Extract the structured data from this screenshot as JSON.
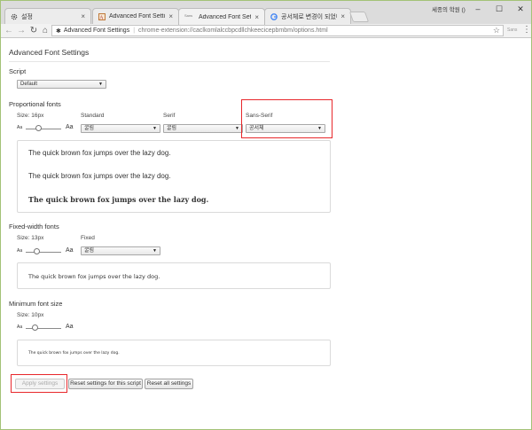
{
  "browser": {
    "tabs": [
      {
        "title": "설정",
        "active": false
      },
      {
        "title": "Advanced Font Settings",
        "active": false
      },
      {
        "title": "Advanced Font Settings",
        "active": true
      },
      {
        "title": "공서체로 변경이 되었네",
        "active": false
      }
    ],
    "profile": "세종의 학원 ()",
    "omnibox": {
      "site_label": "Advanced Font Settings",
      "url": "chrome-extension://caclkomlalccbpcdllchkeecicepbmbm/options.html"
    },
    "extension_label": "Sans"
  },
  "page": {
    "title": "Advanced Font Settings",
    "script": {
      "heading": "Script",
      "value": "Default"
    },
    "proportional": {
      "heading": "Proportional fonts",
      "size_label": "Size: 16px",
      "slider_min_glyph": "Aa",
      "slider_max_glyph": "Aa",
      "slider_level": 0.35,
      "standard": {
        "label": "Standard",
        "value": "굴림"
      },
      "serif": {
        "label": "Serif",
        "value": "굴림"
      },
      "sans_serif": {
        "label": "Sans-Serif",
        "value": "공서체"
      },
      "samples": [
        "The quick brown fox jumps over the lazy dog.",
        "The quick brown fox jumps over the lazy dog.",
        "The quick brown fox jumps over the lazy dog."
      ]
    },
    "fixed": {
      "heading": "Fixed-width fonts",
      "size_label": "Size: 13px",
      "slider_min_glyph": "Aa",
      "slider_max_glyph": "Aa",
      "slider_level": 0.3,
      "fixed_font": {
        "label": "Fixed",
        "value": "굴림"
      },
      "sample": "The quick brown fox jumps over the lazy dog."
    },
    "minimum": {
      "heading": "Minimum font size",
      "size_label": "Size: 10px",
      "slider_min_glyph": "Aa",
      "slider_max_glyph": "Aa",
      "slider_level": 0.25,
      "sample": "The quick brown fox jumps over the lazy dog."
    },
    "buttons": {
      "apply": "Apply settings",
      "reset_script": "Reset settings for this script",
      "reset_all": "Reset all settings"
    }
  },
  "colors": {
    "highlight": "#e8272b",
    "window_border": "#a3c277"
  }
}
